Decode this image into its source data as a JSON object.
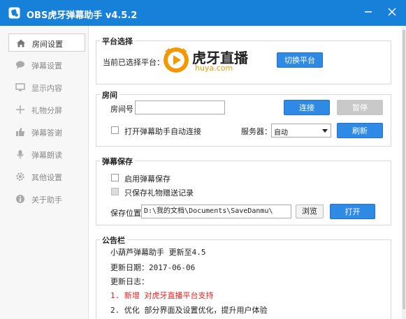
{
  "window": {
    "title": "OBS虎牙弹幕助手 v4.5.2"
  },
  "sidebar": {
    "items": [
      {
        "label": "房间设置",
        "icon": "home-icon"
      },
      {
        "label": "弹幕设置",
        "icon": "chat-bubble-icon"
      },
      {
        "label": "显示内容",
        "icon": "monitor-icon"
      },
      {
        "label": "礼物分屏",
        "icon": "split-screen-icon"
      },
      {
        "label": "弹幕答谢",
        "icon": "thanks-icon"
      },
      {
        "label": "弹幕朗读",
        "icon": "microphone-icon"
      },
      {
        "label": "其他设置",
        "icon": "gear-icon"
      },
      {
        "label": "关于助手",
        "icon": "info-icon"
      }
    ]
  },
  "platform": {
    "title": "平台选择",
    "selected_label": "当前已选择平台：",
    "logo_text": "虎牙直播",
    "logo_url_text": "huya.com",
    "switch_button": "切换平台"
  },
  "room": {
    "title": "房间",
    "room_number_label": "房间号",
    "room_number_value": "",
    "connect_button": "连接",
    "pause_button": "暂停",
    "auto_connect_label": "打开弹幕助手自动连接",
    "server_label": "服务器：",
    "server_value": "自动",
    "refresh_button": "刷新"
  },
  "save": {
    "title": "弹幕保存",
    "enable_label": "启用弹幕保存",
    "gift_only_label": "只保存礼物赠送记录",
    "location_label": "保存位置",
    "location_value": "D:\\我的文档\\Documents\\SaveDanmu\\",
    "browse_button": "浏览",
    "open_button": "打开"
  },
  "announcement": {
    "title": "公告栏",
    "line1": "小葫芦弹幕助手 更新至4.5",
    "line2": "更新日期：2017-06-06",
    "line3": "更新日志：",
    "line4": "1. 新增 对虎牙直播平台支持",
    "line5": "2. 优化 部分界面及设置优化，提升用户体验"
  },
  "colors": {
    "titlebar": "#1781d9",
    "button_primary": "#2f8ae6",
    "huya_orange": "#f39800",
    "highlight_red": "#e02020"
  }
}
